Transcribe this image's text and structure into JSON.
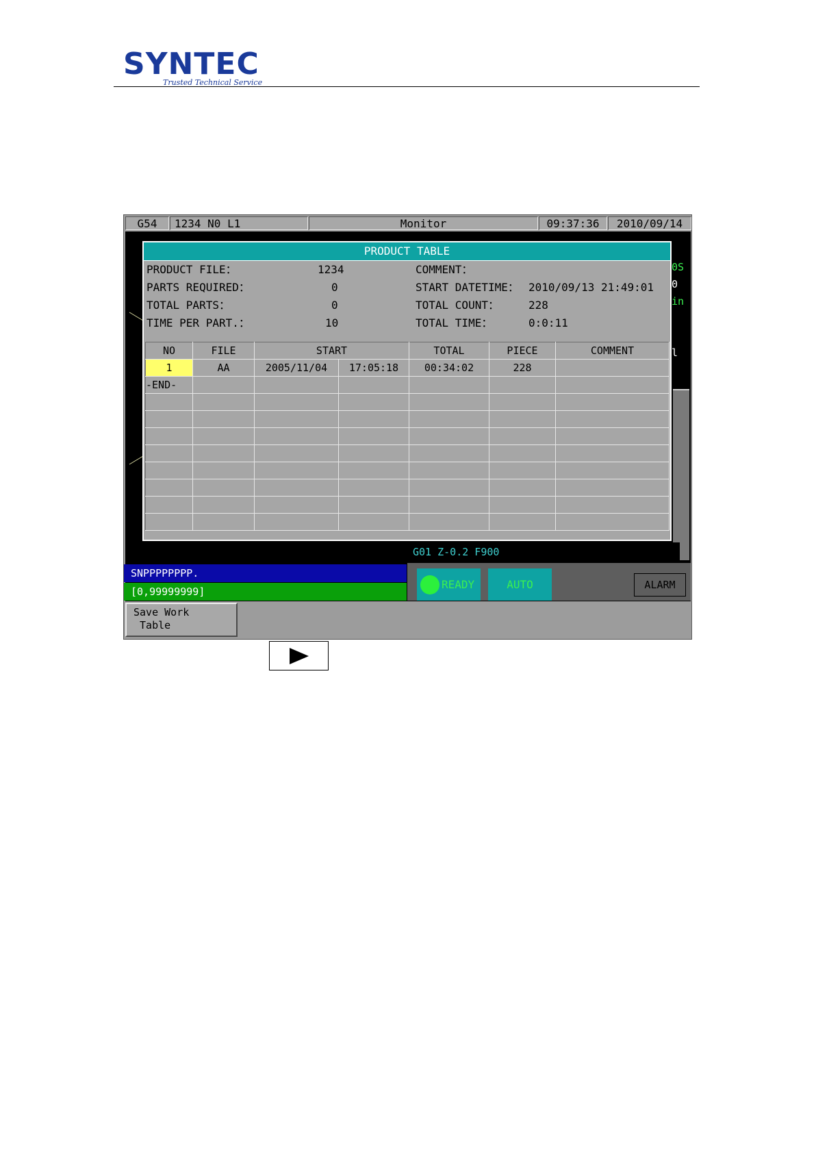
{
  "logo": {
    "name": "SYNTEC",
    "tagline": "Trusted Technical Service"
  },
  "titlebar": {
    "coord_system": "G54",
    "program_info": "1234 N0 L1",
    "mode_title": "Monitor",
    "time": "09:37:36",
    "date": "2010/09/14"
  },
  "background_partial": [
    "0S",
    "0",
    "in",
    "",
    "",
    "l"
  ],
  "dialog": {
    "title": "PRODUCT TABLE",
    "info": {
      "product_file_label": "PRODUCT FILE：",
      "product_file": "1234",
      "parts_required_label": "PARTS REQUIRED：",
      "parts_required": "0",
      "total_parts_label": "TOTAL PARTS：",
      "total_parts": "0",
      "time_per_part_label": "TIME PER PART.：",
      "time_per_part": "10",
      "comment_label": "COMMENT：",
      "comment": "",
      "start_datetime_label": "START DATETIME：",
      "start_datetime": "2010/09/13 21:49:01",
      "total_count_label": "TOTAL COUNT：",
      "total_count": "228",
      "total_time_label": "TOTAL TIME：",
      "total_time": "0:0:11"
    },
    "columns": [
      "NO",
      "FILE",
      "START",
      "TOTAL",
      "PIECE",
      "COMMENT"
    ],
    "rows": [
      {
        "no": "1",
        "file": "AA",
        "start_date": "2005/11/04",
        "start_time": "17:05:18",
        "total": "00:34:02",
        "piece": "228",
        "comment": ""
      },
      {
        "no": "-END-",
        "file": "",
        "start_date": "",
        "start_time": "",
        "total": "",
        "piece": "",
        "comment": ""
      }
    ],
    "empty_row_count": 8
  },
  "program_line": "G01 Z-0.2 F900",
  "input_prompt": "SNPPPPPPPP.",
  "input_range": "[0,99999999]",
  "status": {
    "ready": "READY",
    "auto": "AUTO",
    "alarm": "ALARM"
  },
  "softkeys": {
    "key1": "Save Work\n Table"
  },
  "colors": {
    "teal": "#0ea3a3",
    "highlight": "#ffff6b",
    "prompt_blue": "#0a0aa8",
    "range_green": "#0aa00a",
    "led_green": "#2cf03c"
  },
  "next_key_icon": "play-triangle-icon"
}
